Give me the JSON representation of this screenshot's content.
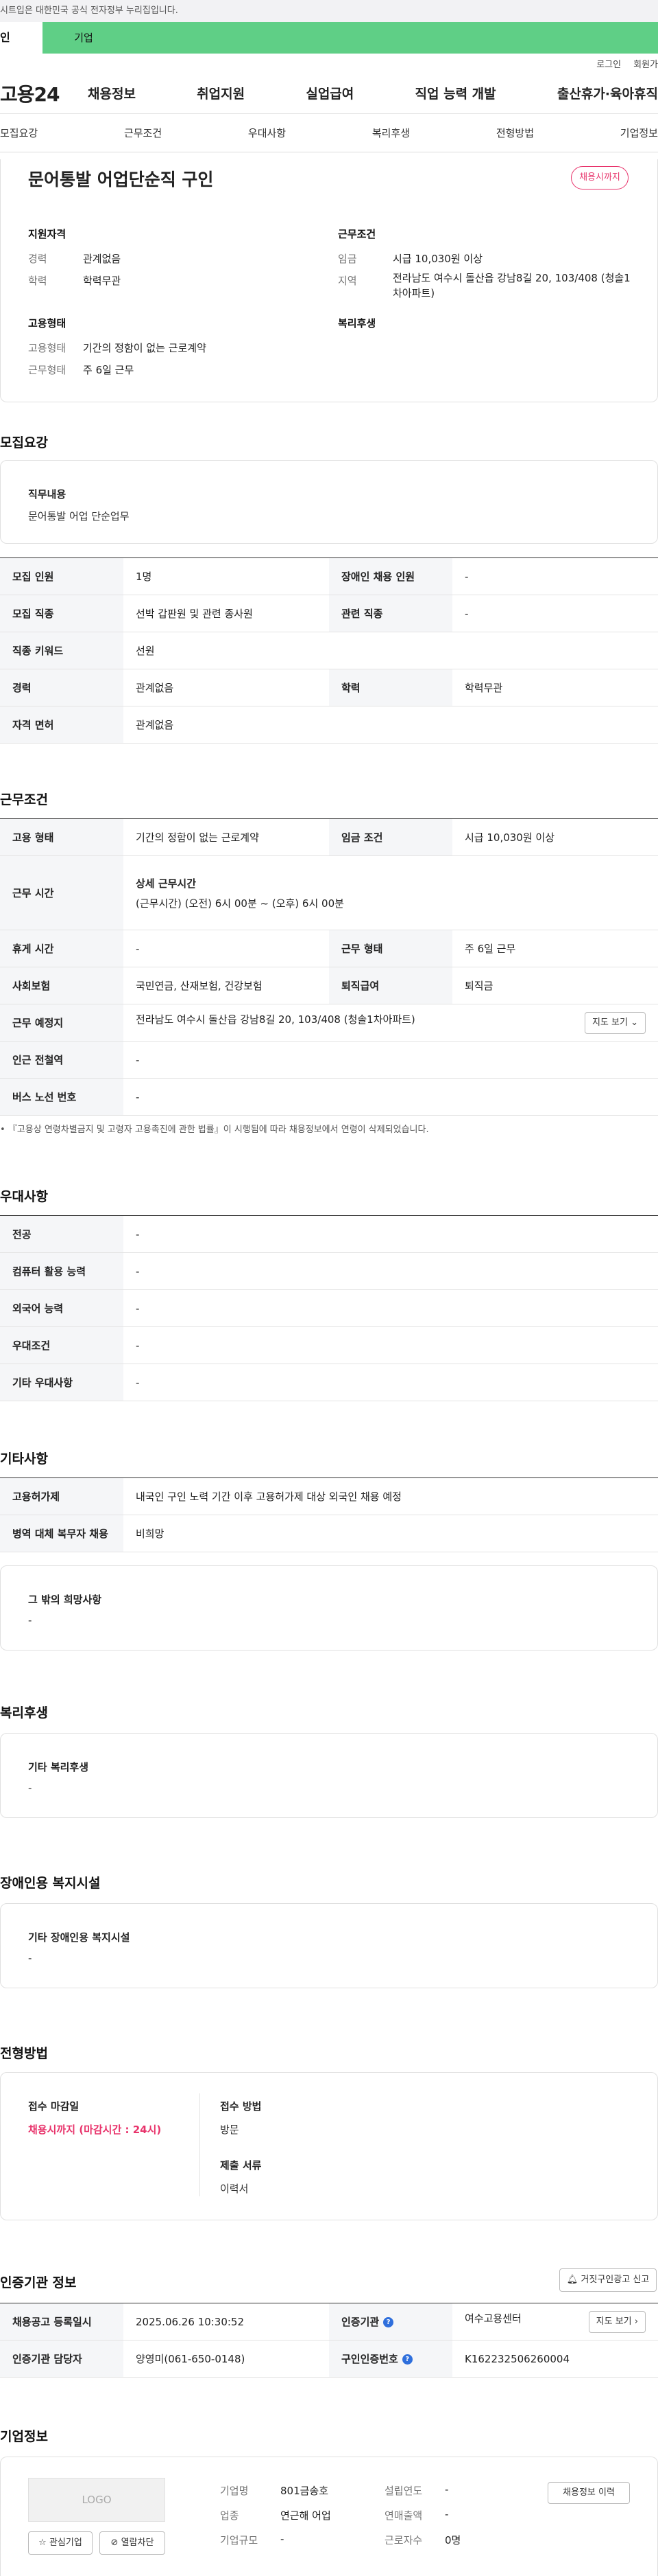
{
  "banner": {
    "text": "시트입은 대한민국 공식 전자정부 누리집입니다."
  },
  "tabs": {
    "user": "인",
    "biz": "기업"
  },
  "util": {
    "login": "로그인",
    "join": "회원가"
  },
  "gnb": {
    "logo": "고용24",
    "items": [
      "채용정보",
      "취업지원",
      "실업급여",
      "직업 능력 개발",
      "출산휴가·육아휴직"
    ]
  },
  "subnav": [
    "모집요강",
    "근무조건",
    "우대사항",
    "복리후생",
    "전형방법",
    "기업정보"
  ],
  "job": {
    "title": "문어통발 어업단순직 구인",
    "deadline_badge": "채용시까지",
    "support_h": "지원자격",
    "career_k": "경력",
    "career_v": "관계없음",
    "edu_k": "학력",
    "edu_v": "학력무관",
    "cond_h": "근무조건",
    "wage_k": "임금",
    "wage_v": "시급 10,030원 이상",
    "region_k": "지역",
    "region_v1": "전라남도 여수시 돌산읍 강남8길 20, 103/408 (청솔1",
    "region_v2": "차아파트)",
    "emp_h": "고용형태",
    "emptype_k": "고용형태",
    "emptype_v": "기간의 정함이 없는 근로계약",
    "workform_k": "근무형태",
    "workform_v": "주 6일 근무",
    "welfare_h": "복리후생"
  },
  "recruit": {
    "title": "모집요강",
    "duty_h": "직무내용",
    "duty_v": "문어통발 어업 단순업무",
    "rows": [
      [
        "모집 인원",
        "1명",
        "장애인 채용 인원",
        "-"
      ],
      [
        "모집 직종",
        "선박 갑판원 및 관련 종사원",
        "관련 직종",
        "-"
      ],
      [
        "직종 키워드",
        "선원",
        "",
        ""
      ],
      [
        "경력",
        "관계없음",
        "학력",
        "학력무관"
      ],
      [
        "자격 면허",
        "관계없음",
        "",
        ""
      ]
    ]
  },
  "conditions": {
    "title": "근무조건",
    "emp_type_k": "고용 형태",
    "emp_type_v": "기간의 정함이 없는 근로계약",
    "wage_k": "임금 조건",
    "wage_v": "시급 10,030원 이상",
    "hours_k": "근무 시간",
    "hours_h": "상세 근무시간",
    "hours_v": "(근무시간) (오전) 6시 00분 ~ (오후) 6시 00분",
    "rest_k": "휴게 시간",
    "rest_v": "-",
    "form_k": "근무 형태",
    "form_v": "주 6일 근무",
    "ins_k": "사회보험",
    "ins_v": "국민연금, 산재보험, 건강보험",
    "retire_k": "퇴직급여",
    "retire_v": "퇴직금",
    "place_k": "근무 예정지",
    "place_v": "전라남도 여수시 돌산읍 강남8길 20, 103/408 (청솔1차아파트)",
    "map_btn": "지도 보기",
    "subway_k": "인근 전철역",
    "subway_v": "-",
    "bus_k": "버스 노선 번호",
    "bus_v": "-",
    "note": "『고용상 연령차별금지 및 고령자 고용촉진에 관한 법률』이 시행됨에 따라 채용정보에서 연령이 삭제되었습니다."
  },
  "pref": {
    "title": "우대사항",
    "rows": [
      [
        "전공",
        "-"
      ],
      [
        "컴퓨터 활용 능력",
        "-"
      ],
      [
        "외국어 능력",
        "-"
      ],
      [
        "우대조건",
        "-"
      ],
      [
        "기타 우대사항",
        "-"
      ]
    ]
  },
  "etc": {
    "title": "기타사항",
    "rows": [
      [
        "고용허가제",
        "내국인 구인 노력 기간 이후 고용허가제 대상 외국인 채용 예정"
      ],
      [
        "병역 대체 복무자 채용",
        "비희망"
      ]
    ],
    "other_h": "그 밖의 희망사항",
    "other_v": "-"
  },
  "welfare": {
    "title": "복리후생",
    "h": "기타 복리후생",
    "v": "-"
  },
  "disabled": {
    "title": "장애인용 복지시설",
    "h": "기타 장애인용 복지시설",
    "v": "-"
  },
  "screening": {
    "title": "전형방법",
    "deadline_h": "접수 마감일",
    "deadline_v": "채용시까지 (마감시간 : 24시)",
    "method_h": "접수 방법",
    "method_v": "방문",
    "docs_h": "제출 서류",
    "docs_v": "이력서"
  },
  "agency": {
    "title": "인증기관 정보",
    "report_btn": "거짓구인광고 신고",
    "reg_k": "채용공고 등록일시",
    "reg_v": "2025.06.26 10:30:52",
    "org_k": "인증기관",
    "org_v": "여수고용센터",
    "map_btn": "지도 보기",
    "staff_k": "인증기관 담당자",
    "staff_v": "양영미(061-650-0148)",
    "num_k": "구인인증번호",
    "num_v": "K162232506260004"
  },
  "company": {
    "title": "기업정보",
    "logo_text": "LOGO",
    "interest_btn": "관심기업",
    "block_btn": "열람차단",
    "history_btn": "채용정보 이력",
    "name_k": "기업명",
    "name_v": "801금송호",
    "year_k": "설립연도",
    "year_v": "-",
    "industry_k": "업종",
    "industry_v": "연근해 어업",
    "sales_k": "연매출액",
    "sales_v": "-",
    "size_k": "기업규모",
    "size_v": "-",
    "workers_k": "근로자수",
    "workers_v": "0명"
  }
}
